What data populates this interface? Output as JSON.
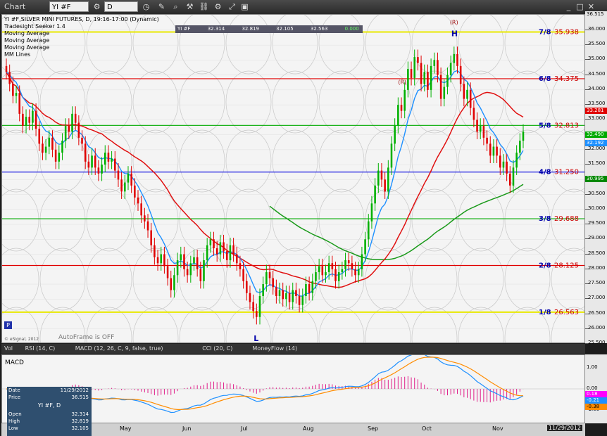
{
  "toolbar": {
    "title": "Chart",
    "symbol": "YI #F",
    "interval": "D"
  },
  "study_legend": [
    "YI #F,SILVER MINI FUTURES, D, 19:16-17:00 (Dynamic)",
    "Tradesight Seeker 1.4",
    "Moving Average",
    "Moving Average",
    "Moving Average",
    "MM Lines"
  ],
  "quote_bar": {
    "symbol": "YI #F",
    "last": "32.314",
    "high": "32.819",
    "low": "32.105",
    "close": "32.563",
    "chg": "0.000"
  },
  "mm_lines": [
    {
      "label": "7/8",
      "value": "35.938",
      "price": 35.938,
      "color": "#e8e800"
    },
    {
      "label": "6/8",
      "value": "34.375",
      "price": 34.375,
      "color": "#e00000"
    },
    {
      "label": "5/8",
      "value": "32.813",
      "price": 32.813,
      "color": "#00aa00"
    },
    {
      "label": "4/8",
      "value": "31.250",
      "price": 31.25,
      "color": "#0000e0"
    },
    {
      "label": "3/8",
      "value": "29.688",
      "price": 29.688,
      "color": "#00aa00"
    },
    {
      "label": "2/8",
      "value": "28.125",
      "price": 28.125,
      "color": "#e00000"
    },
    {
      "label": "1/8",
      "value": "26.563",
      "price": 26.563,
      "color": "#e8e800"
    }
  ],
  "annotations": {
    "h": "H",
    "l": "L",
    "r1": "(R)",
    "r2": "(R)",
    "p_badge": "P",
    "autoframe": "AutoFrame is OFF",
    "esignal": "© eSignal, 2012"
  },
  "price_tags": [
    {
      "value": "36.515",
      "price": 36.515,
      "bg": "#e8e8e8",
      "fg": "#000"
    },
    {
      "value": "33.281",
      "price": 33.281,
      "bg": "#e00000",
      "fg": "#fff"
    },
    {
      "value": "32.490",
      "price": 32.49,
      "bg": "#00aa00",
      "fg": "#fff"
    },
    {
      "value": "32.192",
      "price": 32.192,
      "bg": "#1e90ff",
      "fg": "#fff"
    },
    {
      "value": "30.995",
      "price": 30.995,
      "bg": "#008800",
      "fg": "#fff"
    }
  ],
  "indicator_tabs": [
    "Vol",
    "RSI (14, C)",
    "MACD (12, 26, C, 9, false, true)",
    "CCI (20, C)",
    "MoneyFlow (14)"
  ],
  "macd": {
    "title": "MACD",
    "ticks": [
      "1.00",
      "0.00",
      "-1.00"
    ],
    "tags": [
      {
        "value": "0.18",
        "bg": "#ff00ff",
        "fg": "#fff"
      },
      {
        "value": "-0.21",
        "bg": "#1e90ff",
        "fg": "#fff"
      },
      {
        "value": "-0.38",
        "bg": "#ff8c00",
        "fg": "#000"
      }
    ]
  },
  "data_window": {
    "date_label": "Date",
    "date": "11/29/2012",
    "price_label": "Price",
    "price": "36.515",
    "symbol": "YI #F, D",
    "open_label": "Open",
    "open": "32.314",
    "high_label": "High",
    "high": "32.819",
    "low_label": "Low",
    "low": "32.105"
  },
  "date_axis": {
    "labels": [
      "May",
      "Jun",
      "Jul",
      "Aug",
      "Sep",
      "Oct",
      "Nov"
    ],
    "cursor_date": "11/29/2012"
  },
  "chart_data": {
    "type": "candlestick",
    "title": "YI #F,SILVER MINI FUTURES, D, 19:16-17:00 (Dynamic)",
    "ylim": [
      25.5,
      36.515
    ],
    "yticks": [
      25.5,
      26.0,
      26.5,
      27.0,
      27.5,
      28.0,
      28.5,
      29.0,
      29.5,
      30.0,
      30.5,
      31.0,
      31.5,
      32.0,
      32.5,
      33.0,
      33.5,
      34.0,
      34.5,
      35.0,
      35.5,
      36.0
    ],
    "ytick_labels": [
      "25.500",
      "26.000",
      "26.500",
      "27.000",
      "27.500",
      "28.000",
      "28.500",
      "29.000",
      "29.500",
      "30.000",
      "30.500",
      "31.000",
      "31.500",
      "32.000",
      "32.500",
      "33.000",
      "33.500",
      "34.000",
      "34.500",
      "35.000",
      "35.500",
      "36.000"
    ],
    "close": [
      34.6,
      34.2,
      33.8,
      33.9,
      33.2,
      32.8,
      33.1,
      32.9,
      33.3,
      32.7,
      32.2,
      31.9,
      32.1,
      32.4,
      32.0,
      31.6,
      31.9,
      32.3,
      32.8,
      32.6,
      33.2,
      32.9,
      32.4,
      32.2,
      31.6,
      31.4,
      31.8,
      31.4,
      31.2,
      31.5,
      31.9,
      31.6,
      31.7,
      31.3,
      31.0,
      30.6,
      30.9,
      31.2,
      30.8,
      30.4,
      30.2,
      29.8,
      29.6,
      29.3,
      28.8,
      28.4,
      28.2,
      28.5,
      28.1,
      27.7,
      27.3,
      27.8,
      28.3,
      28.5,
      28.0,
      27.8,
      28.2,
      28.4,
      28.0,
      27.6,
      28.3,
      28.8,
      29.0,
      28.7,
      28.5,
      28.9,
      28.6,
      28.3,
      28.8,
      28.5,
      28.2,
      28.0,
      27.6,
      27.2,
      26.9,
      26.6,
      26.4,
      27.1,
      27.5,
      27.9,
      27.7,
      27.4,
      27.1,
      27.3,
      27.0,
      27.2,
      26.9,
      27.3,
      27.1,
      26.8,
      27.1,
      27.5,
      27.2,
      27.6,
      27.9,
      28.1,
      27.8,
      27.9,
      28.2,
      28.0,
      27.6,
      27.9,
      28.0,
      28.3,
      28.2,
      28.0,
      27.8,
      28.0,
      28.5,
      29.0,
      29.6,
      30.2,
      30.8,
      31.3,
      31.0,
      30.6,
      31.4,
      32.2,
      32.8,
      33.5,
      33.3,
      34.0,
      34.7,
      34.4,
      35.1,
      34.9,
      34.2,
      34.6,
      34.0,
      34.8,
      35.0,
      34.5,
      33.7,
      34.1,
      34.5,
      34.9,
      35.2,
      34.8,
      34.2,
      33.7,
      34.0,
      33.4,
      33.0,
      32.6,
      32.8,
      32.4,
      32.2,
      31.8,
      32.1,
      31.8,
      31.4,
      31.6,
      31.2,
      30.8,
      31.4,
      31.9,
      32.3,
      32.6
    ]
  }
}
